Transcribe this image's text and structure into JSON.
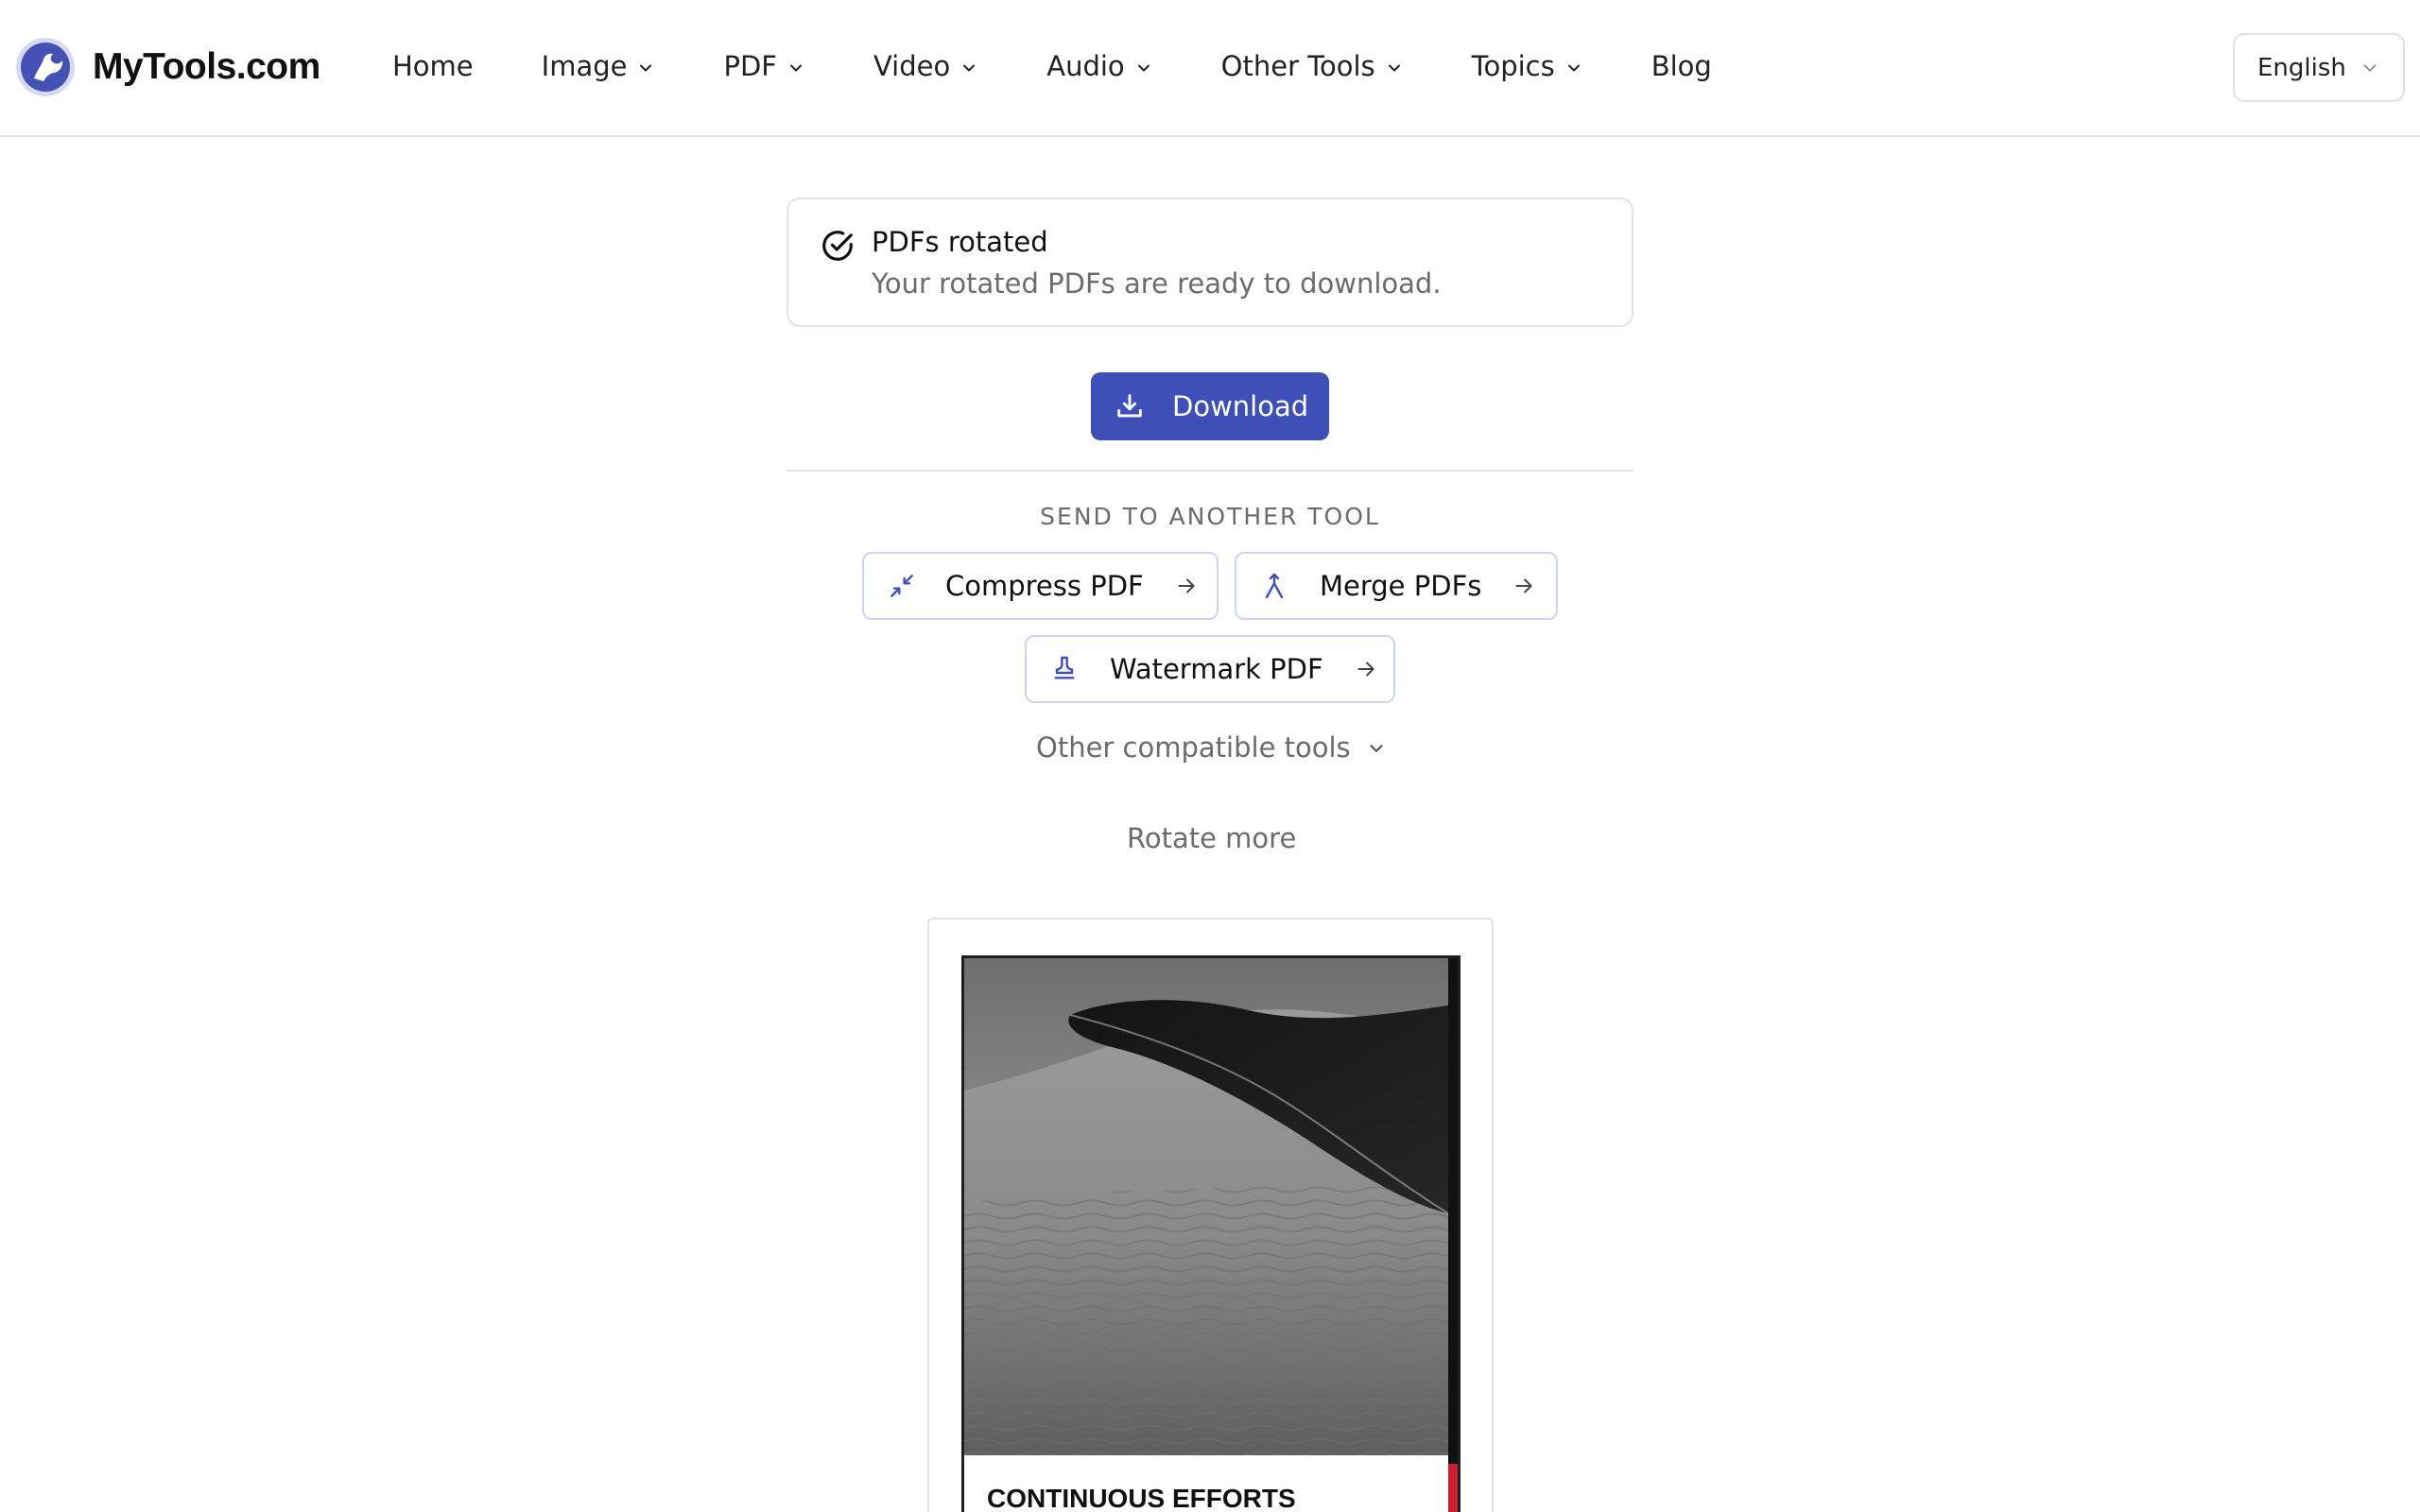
{
  "header": {
    "logo_text": "MyTools.com",
    "nav": {
      "home": "Home",
      "image": "Image",
      "pdf": "PDF",
      "video": "Video",
      "audio": "Audio",
      "other_tools": "Other Tools",
      "topics": "Topics",
      "blog": "Blog"
    },
    "language": "English"
  },
  "alert": {
    "title": "PDFs rotated",
    "description": "Your rotated PDFs are ready to download.",
    "icon": "check-circle-icon"
  },
  "download": {
    "label": "Download",
    "icon": "download-icon",
    "color": "#3f4fb8"
  },
  "send_to": {
    "label": "SEND TO ANOTHER TOOL",
    "tools": [
      {
        "label": "Compress PDF",
        "icon": "compress-icon"
      },
      {
        "label": "Merge PDFs",
        "icon": "merge-icon"
      },
      {
        "label": "Watermark PDF",
        "icon": "stamp-icon"
      }
    ],
    "other_label": "Other compatible tools"
  },
  "rotate_more": "Rotate more",
  "preview": {
    "caption": "CONTINUOUS EFFORTS"
  },
  "colors": {
    "accent": "#3f4fb8",
    "border": "#e3e3e3",
    "muted_text": "#6b6b6b"
  }
}
